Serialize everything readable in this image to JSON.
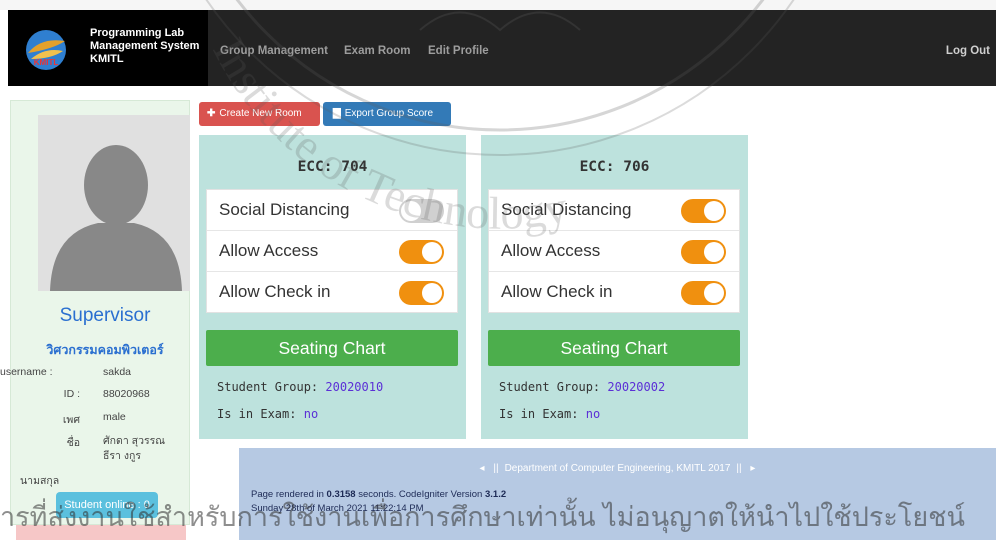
{
  "navbar": {
    "brand_line1": "Programming Lab",
    "brand_line2": "Management System",
    "brand_line3": "KMITL",
    "logo_text": "KMITL",
    "links": [
      "Group Management",
      "Exam Room",
      "Edit Profile"
    ],
    "logout_label": "Log Out"
  },
  "sidebar": {
    "role": "Supervisor",
    "department": "วิศวกรรมคอมพิวเตอร์",
    "username_label": "username :",
    "username": "sakda",
    "id_label": "ID :",
    "id": "88020968",
    "gender_label": "เพศ",
    "gender": "male",
    "name_label": "ชื่อ",
    "name": "ศักดา สุวรรณธีรา งกูร",
    "surname_label": "นามสกุล",
    "online_label": "Student online : 0"
  },
  "toolbar": {
    "create_label": "Create New Room",
    "create_icon": "plus-icon",
    "export_label": "Export Group Score",
    "export_icon": "file-icon"
  },
  "rooms": [
    {
      "title": "ECC: 704",
      "toggles": [
        {
          "label": "Social Distancing",
          "on": false
        },
        {
          "label": "Allow Access",
          "on": true
        },
        {
          "label": "Allow Check in",
          "on": true
        }
      ],
      "seating_label": "Seating Chart",
      "group_label": "Student Group:",
      "group_value": "20020010",
      "exam_label": "Is in Exam:",
      "exam_value": "no"
    },
    {
      "title": "ECC: 706",
      "toggles": [
        {
          "label": "Social Distancing",
          "on": true
        },
        {
          "label": "Allow Access",
          "on": true
        },
        {
          "label": "Allow Check in",
          "on": true
        }
      ],
      "seating_label": "Seating Chart",
      "group_label": "Student Group:",
      "group_value": "20020002",
      "exam_label": "Is in Exam:",
      "exam_value": "no"
    }
  ],
  "footer": {
    "dept": "Department of Computer Engineering, KMITL 2017",
    "rendered_prefix": "Page rendered in",
    "rendered_time": "0.3158",
    "rendered_suffix": "seconds. CodeIgniter Version",
    "ci_version": "3.1.2",
    "date": "Sunday 28th of March 2021 11:22:14 PM"
  },
  "watermark": {
    "arc_text": "Institute of Technology",
    "bottom_text": "ารที่ส่งงานใช้สำหรับการใช้งานเพื่อการศึกษาเท่านั้น ไม่อนุญาตให้นำไปใช้ประโยชน์"
  },
  "colors": {
    "navbar": "#232323",
    "card": "#bde2dd",
    "toggle_on": "#f0900f",
    "seating": "#4cae4c",
    "create": "#d9534f",
    "export": "#337ab7",
    "footer": "#b6c9e3"
  }
}
